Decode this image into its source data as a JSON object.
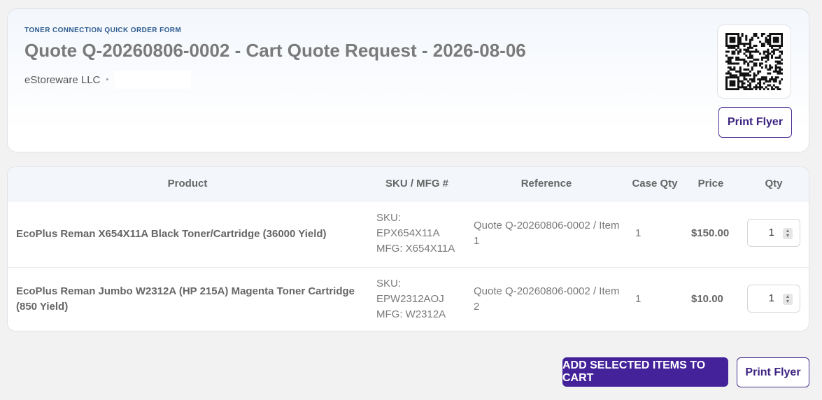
{
  "header": {
    "eyebrow": "TONER CONNECTION QUICK ORDER FORM",
    "title": "Quote Q-20260806-0002 - Cart Quote Request - 2026-08-06",
    "company": "eStoreware LLC",
    "separator": "•",
    "qr_icon": "qr-code-icon",
    "print_flyer_label": "Print Flyer"
  },
  "table": {
    "columns": [
      "Product",
      "SKU / MFG #",
      "Reference",
      "Case Qty",
      "Price",
      "Qty"
    ],
    "rows": [
      {
        "product": "EcoPlus Reman X654X11A Black Toner/Cartridge (36000 Yield)",
        "sku_label": "SKU:",
        "sku": "EPX654X11A",
        "mfg": "MFG: X654X11A",
        "reference": "Quote Q-20260806-0002 / Item 1",
        "case_qty": "1",
        "price": "$150.00",
        "qty": "1"
      },
      {
        "product": "EcoPlus Reman Jumbo W2312A (HP 215A) Magenta Toner Cartridge (850 Yield)",
        "sku_label": "SKU:",
        "sku": "EPW2312AOJ",
        "mfg": "MFG: W2312A",
        "reference": "Quote Q-20260806-0002 / Item 2",
        "case_qty": "1",
        "price": "$10.00",
        "qty": "1"
      }
    ]
  },
  "footer": {
    "add_to_cart_label": "ADD SELECTED ITEMS TO CART",
    "print_flyer_label": "Print Flyer"
  },
  "colors": {
    "accent": "#44239a",
    "eyebrow": "#2d5b8f"
  }
}
